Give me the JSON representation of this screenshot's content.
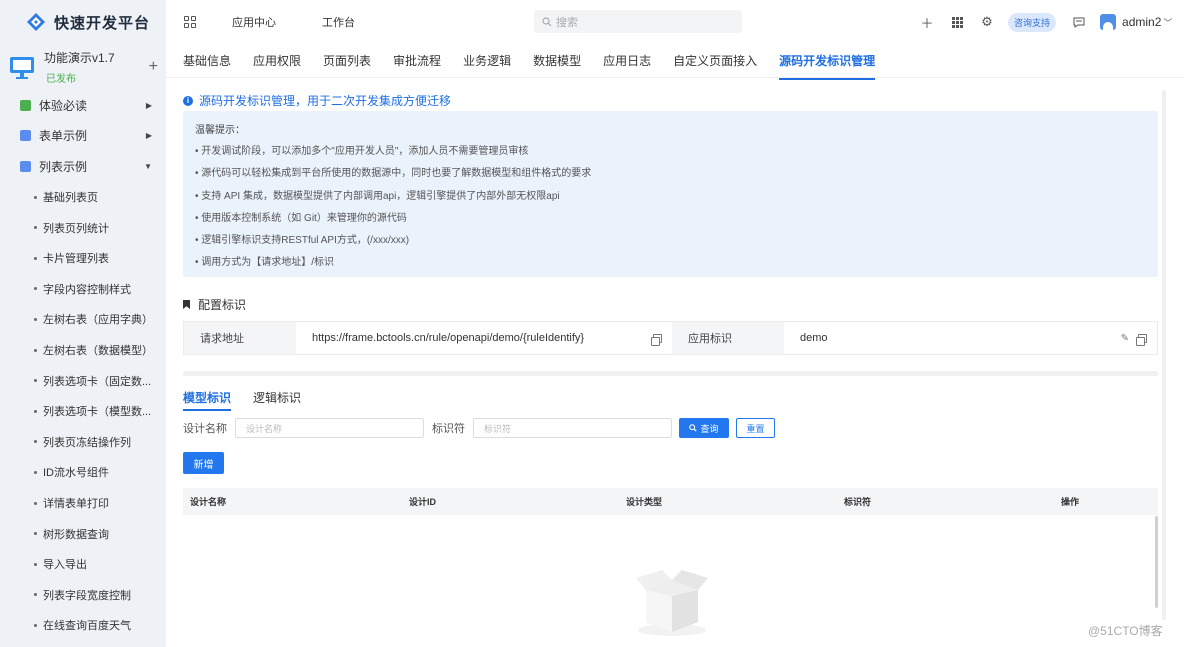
{
  "brand": {
    "name": "快速开发平台"
  },
  "app": {
    "name": "功能演示v1.7",
    "status": "已发布",
    "add_symbol": "+"
  },
  "sidebar": {
    "groups": [
      {
        "label": "体验必读",
        "color": "#4caf50"
      },
      {
        "label": "表单示例",
        "color": "#5b8def"
      },
      {
        "label": "列表示例",
        "color": "#5b8def"
      }
    ],
    "items": [
      "基础列表页",
      "列表页列统计",
      "卡片管理列表",
      "字段内容控制样式",
      "左树右表（应用字典）",
      "左树右表（数据模型）",
      "列表选项卡（固定数...",
      "列表选项卡（模型数...",
      "列表页冻结操作列",
      "ID流水号组件",
      "详情表单打印",
      "树形数据查询",
      "导入导出",
      "列表字段宽度控制",
      "在线查询百度天气"
    ]
  },
  "topbar": {
    "nav": [
      "应用中心",
      "工作台"
    ],
    "search_placeholder": "搜索",
    "help_label": "咨询支持",
    "username": "admin2"
  },
  "tabs": [
    {
      "label": "基础信息",
      "active": false
    },
    {
      "label": "应用权限",
      "active": false
    },
    {
      "label": "页面列表",
      "active": false
    },
    {
      "label": "审批流程",
      "active": false
    },
    {
      "label": "业务逻辑",
      "active": false
    },
    {
      "label": "数据模型",
      "active": false
    },
    {
      "label": "应用日志",
      "active": false
    },
    {
      "label": "自定义页面接入",
      "active": false
    },
    {
      "label": "源码开发标识管理",
      "active": true
    }
  ],
  "section": {
    "title": "源码开发标识管理，用于二次开发集成方便迁移"
  },
  "tips": {
    "title": "温馨提示：",
    "lines": [
      "• 开发调试阶段，可以添加多个\"应用开发人员\"，添加人员不需要管理员审核",
      "• 源代码可以轻松集成到平台所使用的数据源中，同时也要了解数据模型和组件格式的要求",
      "• 支持 API 集成，数据模型提供了内部调用api，逻辑引擎提供了内部外部无权限api",
      "• 使用版本控制系统（如 Git）来管理你的源代码",
      "• 逻辑引擎标识支持RESTful API方式，(/xxx/xxx)",
      "• 调用方式为【请求地址】/标识"
    ]
  },
  "config": {
    "title": "配置标识",
    "url_label": "请求地址",
    "url_value": "https://frame.bctools.cn/rule/openapi/demo/{ruleIdentify}",
    "app_label": "应用标识",
    "app_value": "demo"
  },
  "subtabs": [
    {
      "label": "模型标识",
      "active": true
    },
    {
      "label": "逻辑标识",
      "active": false
    }
  ],
  "filter": {
    "name_label": "设计名称",
    "name_placeholder": "设计名称",
    "id_label": "标识符",
    "id_placeholder": "标识符",
    "query_label": "查询",
    "reset_label": "重置"
  },
  "add_label": "新增",
  "table": {
    "columns": [
      "设计名称",
      "设计ID",
      "设计类型",
      "标识符",
      "操作"
    ]
  },
  "watermark": "@51CTO博客",
  "colors": {
    "primary": "#1f6fe3",
    "sidebar_bg": "#eef1f6",
    "tips_bg": "#eaf2fc"
  }
}
